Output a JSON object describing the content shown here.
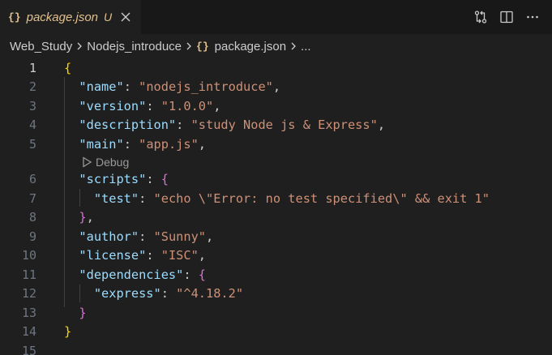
{
  "tab": {
    "icon": "{}",
    "filename": "package.json",
    "status": "U"
  },
  "actions": [
    "source-control-compare-icon",
    "split-editor-icon",
    "more-actions-icon"
  ],
  "breadcrumb": {
    "folder": "Web_Study",
    "subfolder": "Nodejs_introduce",
    "icon": "{}",
    "file": "package.json",
    "more": "..."
  },
  "codelens": {
    "label": "Debug"
  },
  "lines": [
    {
      "n": "1"
    },
    {
      "n": "2",
      "key": "\"name\"",
      "value": "\"nodejs_introduce\""
    },
    {
      "n": "3",
      "key": "\"version\"",
      "value": "\"1.0.0\""
    },
    {
      "n": "4",
      "key": "\"description\"",
      "value": "\"study Node js & Express\""
    },
    {
      "n": "5",
      "key": "\"main\"",
      "value": "\"app.js\""
    },
    {
      "n": "6",
      "key": "\"scripts\""
    },
    {
      "n": "7",
      "key": "\"test\"",
      "value": "\"echo \\\"Error: no test specified\\\" && exit 1\""
    },
    {
      "n": "8"
    },
    {
      "n": "9",
      "key": "\"author\"",
      "value": "\"Sunny\""
    },
    {
      "n": "10",
      "key": "\"license\"",
      "value": "\"ISC\""
    },
    {
      "n": "11",
      "key": "\"dependencies\""
    },
    {
      "n": "12",
      "key": "\"express\"",
      "value": "\"^4.18.2\""
    },
    {
      "n": "13"
    },
    {
      "n": "14"
    },
    {
      "n": "15"
    }
  ],
  "colors": {
    "key": "#9cdcfe",
    "string": "#ce9178",
    "bracket_level1": "#ffd700",
    "bracket_level2": "#da70d6",
    "modified": "#e2c08d"
  }
}
